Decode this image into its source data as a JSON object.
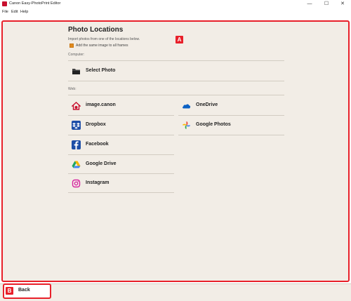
{
  "window": {
    "title": "Canon Easy-PhotoPrint Editor",
    "min": "—",
    "max": "☐",
    "close": "✕"
  },
  "menu": {
    "file": "File",
    "edit": "Edit",
    "help": "Help"
  },
  "markers": {
    "a": "A",
    "b": "B"
  },
  "page": {
    "title": "Photo Locations",
    "description": "Import photos from one of the locations below.",
    "checkbox_label": "Add the same image to all frames",
    "checkbox_checked": true
  },
  "computer": {
    "label": "Computer:",
    "select_photo": "Select Photo"
  },
  "web": {
    "label": "Web:",
    "services": {
      "image_canon": "image.canon",
      "dropbox": "Dropbox",
      "facebook": "Facebook",
      "google_drive": "Google Drive",
      "instagram": "Instagram",
      "onedrive": "OneDrive",
      "google_photos": "Google Photos"
    }
  },
  "footer": {
    "back_label": "Back"
  },
  "colors": {
    "accent_red": "#e8202a",
    "checkbox": "#e08a1f",
    "background": "#f2ede6"
  }
}
